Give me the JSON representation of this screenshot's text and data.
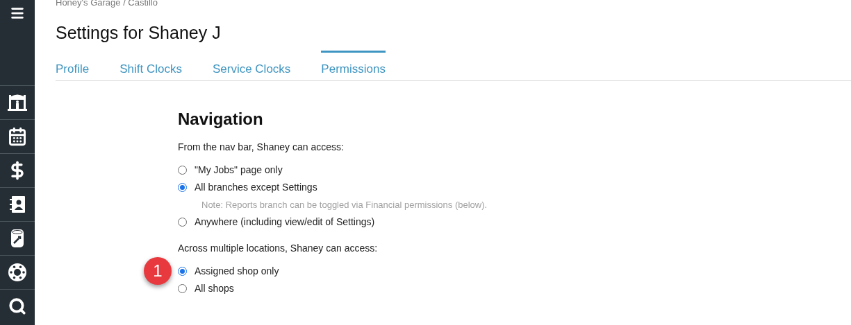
{
  "breadcrumb": "Honey's Garage / Castillo",
  "title": "Settings for Shaney J",
  "tabs": [
    {
      "label": "Profile",
      "selected": false
    },
    {
      "label": "Shift Clocks",
      "selected": false
    },
    {
      "label": "Service Clocks",
      "selected": false
    },
    {
      "label": "Permissions",
      "selected": true
    }
  ],
  "section": {
    "heading": "Navigation",
    "groups": [
      {
        "prompt": "From the nav bar, Shaney can access:",
        "options": [
          {
            "label": "\"My Jobs\" page only",
            "selected": false
          },
          {
            "label": "All branches except Settings",
            "selected": true,
            "note": "Note: Reports branch can be toggled via Financial permissions (below)."
          },
          {
            "label": "Anywhere (including view/edit of Settings)",
            "selected": false
          }
        ]
      },
      {
        "prompt": "Across multiple locations, Shaney can access:",
        "badge": "1",
        "options": [
          {
            "label": "Assigned shop only",
            "selected": true
          },
          {
            "label": "All shops",
            "selected": false
          }
        ]
      }
    ]
  }
}
